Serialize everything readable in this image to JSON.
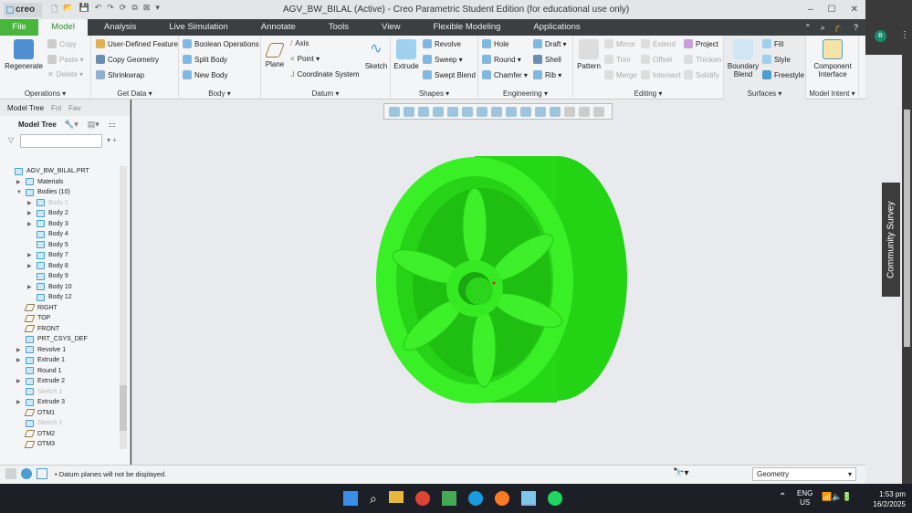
{
  "window": {
    "logo": "creo",
    "title": "AGV_BW_BILAL (Active) - Creo Parametric Student Edition (for educational use only)",
    "min": "–",
    "max": "☐",
    "close": "✕"
  },
  "tabs": [
    "File",
    "Model",
    "Analysis",
    "Live Simulation",
    "Annotate",
    "Tools",
    "View",
    "Flexible Modeling",
    "Applications"
  ],
  "ribbon": {
    "operations": {
      "label": "Operations ▾",
      "regenerate": "Regenerate",
      "copy": "Copy",
      "paste": "Paste ▾",
      "delete": "Delete ▾"
    },
    "getdata": {
      "label": "Get Data ▾",
      "items": [
        "User-Defined Feature",
        "Copy Geometry",
        "Shrinkwrap"
      ]
    },
    "body": {
      "label": "Body ▾",
      "items": [
        "Boolean Operations",
        "Split Body",
        "New Body"
      ]
    },
    "datum": {
      "label": "Datum ▾",
      "plane": "Plane",
      "axis": "Axis",
      "point": "Point ▾",
      "csys": "Coordinate System",
      "sketch": "Sketch"
    },
    "shapes": {
      "label": "Shapes ▾",
      "extrude": "Extrude",
      "revolve": "Revolve",
      "sweep": "Sweep ▾",
      "swept": "Swept Blend"
    },
    "engineering": {
      "label": "Engineering ▾",
      "hole": "Hole",
      "round": "Round ▾",
      "chamfer": "Chamfer ▾",
      "draft": "Draft ▾",
      "shell": "Shell",
      "rib": "Rib ▾"
    },
    "editing": {
      "label": "Editing ▾",
      "pattern": "Pattern",
      "mirror": "Mirror",
      "trim": "Trim",
      "merge": "Merge",
      "extend": "Extend",
      "offset": "Offset",
      "intersect": "Intersect",
      "project": "Project",
      "thicken": "Thicken",
      "solidify": "Solidify"
    },
    "surfaces": {
      "label": "Surfaces ▾",
      "boundary": "Boundary Blend",
      "fill": "Fill",
      "style": "Style",
      "freestyle": "Freestyle"
    },
    "intent": {
      "label": "Model Intent ▾",
      "component": "Component Interface"
    }
  },
  "left": {
    "tabs": [
      "Model Tree",
      "Fol",
      "Fav"
    ],
    "header": "Model Tree",
    "filter_placeholder": "",
    "tree": [
      {
        "t": "AGV_BW_BILAL.PRT",
        "a": "",
        "d": 0,
        "i": "part"
      },
      {
        "t": "Materials",
        "a": "▶",
        "d": 1,
        "i": "mat"
      },
      {
        "t": "Bodies (10)",
        "a": "▼",
        "d": 1,
        "i": "body"
      },
      {
        "t": "Body 1",
        "a": "▶",
        "d": 2,
        "i": "body",
        "g": true
      },
      {
        "t": "Body 2",
        "a": "▶",
        "d": 2,
        "i": "body"
      },
      {
        "t": "Body 3",
        "a": "▶",
        "d": 2,
        "i": "body"
      },
      {
        "t": "Body 4",
        "a": "",
        "d": 2,
        "i": "body"
      },
      {
        "t": "Body 5",
        "a": "",
        "d": 2,
        "i": "body"
      },
      {
        "t": "Body 7",
        "a": "▶",
        "d": 2,
        "i": "body"
      },
      {
        "t": "Body 8",
        "a": "▶",
        "d": 2,
        "i": "body"
      },
      {
        "t": "Body 9",
        "a": "",
        "d": 2,
        "i": "body"
      },
      {
        "t": "Body 10",
        "a": "▶",
        "d": 2,
        "i": "body"
      },
      {
        "t": "Body 12",
        "a": "",
        "d": 2,
        "i": "body"
      },
      {
        "t": "RIGHT",
        "a": "",
        "d": 1,
        "i": "pl"
      },
      {
        "t": "TOP",
        "a": "",
        "d": 1,
        "i": "pl"
      },
      {
        "t": "FRONT",
        "a": "",
        "d": 1,
        "i": "pl"
      },
      {
        "t": "PRT_CSYS_DEF",
        "a": "",
        "d": 1,
        "i": "cs"
      },
      {
        "t": "Revolve 1",
        "a": "▶",
        "d": 1,
        "i": "body"
      },
      {
        "t": "Extrude 1",
        "a": "▶",
        "d": 1,
        "i": "body"
      },
      {
        "t": "Round 1",
        "a": "",
        "d": 1,
        "i": "body"
      },
      {
        "t": "Extrude 2",
        "a": "▶",
        "d": 1,
        "i": "body"
      },
      {
        "t": "Sketch 1",
        "a": "",
        "d": 1,
        "i": "sk",
        "g": true
      },
      {
        "t": "Extrude 3",
        "a": "▶",
        "d": 1,
        "i": "body"
      },
      {
        "t": "DTM1",
        "a": "",
        "d": 1,
        "i": "pl"
      },
      {
        "t": "Sketch 2",
        "a": "",
        "d": 1,
        "i": "sk",
        "g": true
      },
      {
        "t": "DTM2",
        "a": "",
        "d": 1,
        "i": "pl"
      },
      {
        "t": "DTM3",
        "a": "",
        "d": 1,
        "i": "pl"
      }
    ]
  },
  "status": {
    "message": "• Datum planes will not be displayed.",
    "filter": "Geometry"
  },
  "side": {
    "survey": "Community Survey",
    "avatar": "B"
  },
  "tray": {
    "lang1": "ENG",
    "lang2": "US",
    "time": "1:53 pm",
    "date": "16/2/2025"
  },
  "colors": {
    "model": "#33ee22",
    "ribbon_tab": "#3b3f42",
    "file_tab": "#4bb43f"
  }
}
